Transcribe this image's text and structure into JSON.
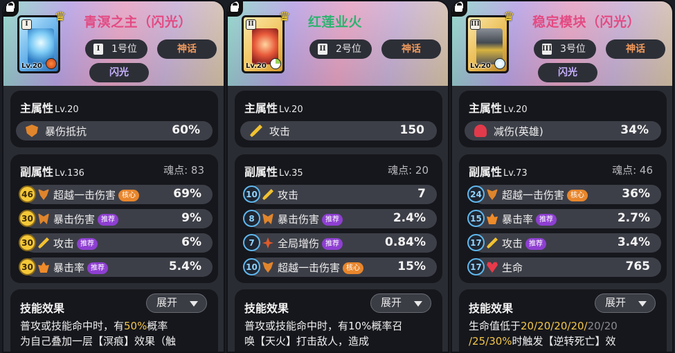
{
  "labels": {
    "main_attr": "主属性",
    "sub_attr": "副属性",
    "soul": "魂点:",
    "skill_effect": "技能效果",
    "expand": "展开",
    "tag_core": "核心",
    "tag_recommend": "推荐"
  },
  "cards": [
    {
      "title": "青溟之主（闪光）",
      "title_color": "#e34a82",
      "thumb_roman": "I",
      "thumb_level": "Lv.20",
      "position": "1号位",
      "position_roman": "I",
      "rarity": "神话",
      "flash": "闪光",
      "main_level": "Lv.20",
      "main_stat": {
        "name": "暴伤抵抗",
        "value": "60%",
        "icon": "shield-crit-icon"
      },
      "sub_level": "Lv.136",
      "soul": "83",
      "sub_stats": [
        {
          "count": "46",
          "name": "超越一击伤害",
          "tag": "核心",
          "value": "69%",
          "icon": "wing-icon"
        },
        {
          "count": "30",
          "name": "暴击伤害",
          "tag": "推荐",
          "value": "9%",
          "icon": "crit-damage-icon"
        },
        {
          "count": "30",
          "name": "攻击",
          "tag": "推荐",
          "value": "6%",
          "icon": "sword-icon"
        },
        {
          "count": "30",
          "name": "暴击率",
          "tag": "推荐",
          "value": "5.4%",
          "icon": "crit-rate-icon"
        }
      ],
      "skill_line1_a": "普攻或技能命中时，有",
      "skill_line1_hl": "50%",
      "skill_line1_b": "概率",
      "skill_line2": "为自己叠加一层【溟痕】效果（触"
    },
    {
      "title": "红莲业火",
      "title_color": "#2bb36f",
      "thumb_roman": "II",
      "thumb_level": "Lv.20",
      "position": "2号位",
      "position_roman": "II",
      "rarity": "神话",
      "main_level": "Lv.20",
      "main_stat": {
        "name": "攻击",
        "value": "150",
        "icon": "sword-icon"
      },
      "sub_level": "Lv.35",
      "soul": "20",
      "sub_stats": [
        {
          "count": "10",
          "name": "攻击",
          "tag": "",
          "value": "7",
          "icon": "sword-icon"
        },
        {
          "count": "8",
          "name": "暴击伤害",
          "tag": "推荐",
          "value": "2.4%",
          "icon": "crit-damage-icon"
        },
        {
          "count": "7",
          "name": "全局增伤",
          "tag": "推荐",
          "value": "0.84%",
          "icon": "global-damage-icon"
        },
        {
          "count": "10",
          "name": "超越一击伤害",
          "tag": "核心",
          "value": "15%",
          "icon": "wing-icon"
        }
      ],
      "skill_line1": "普攻或技能命中时，有10%概率召",
      "skill_line2": "唤【天火】打击敌人，造成"
    },
    {
      "title": "稳定模块（闪光）",
      "title_color": "#e34a82",
      "thumb_roman": "III",
      "thumb_level": "Lv.20",
      "position": "3号位",
      "position_roman": "III",
      "rarity": "神话",
      "flash": "闪光",
      "main_level": "Lv.20",
      "main_stat": {
        "name": "减伤(英雄)",
        "value": "34%",
        "icon": "hero-defense-icon"
      },
      "sub_level": "Lv.73",
      "soul": "46",
      "sub_stats": [
        {
          "count": "24",
          "name": "超越一击伤害",
          "tag": "核心",
          "value": "36%",
          "icon": "wing-icon"
        },
        {
          "count": "15",
          "name": "暴击率",
          "tag": "推荐",
          "value": "2.7%",
          "icon": "crit-rate-icon"
        },
        {
          "count": "17",
          "name": "攻击",
          "tag": "推荐",
          "value": "3.4%",
          "icon": "sword-icon"
        },
        {
          "count": "17",
          "name": "生命",
          "tag": "",
          "value": "765",
          "icon": "heart-icon"
        }
      ],
      "skill_line1_a": "生命值低于",
      "skill_line1_hl": "20/20/20/20/",
      "skill_line1_dim": "20/20",
      "skill_line2_a": "/25/30%",
      "skill_line2_b": "时触发【逆转死亡】效"
    }
  ]
}
